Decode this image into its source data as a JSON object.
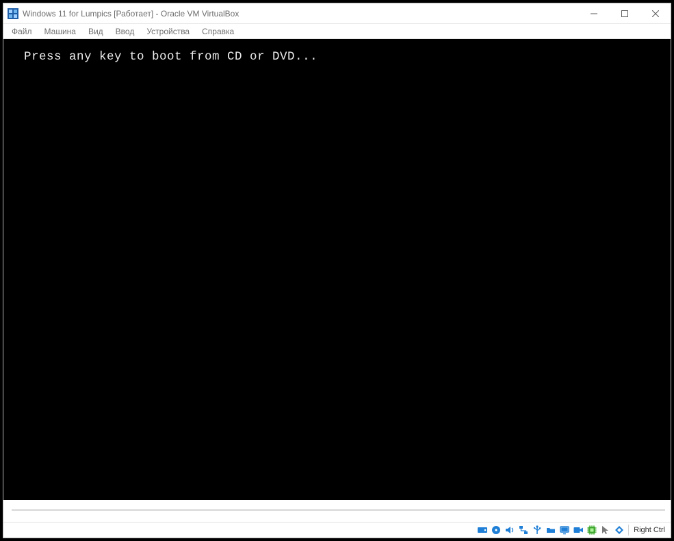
{
  "window": {
    "title": "Windows 11 for Lumpics [Работает] - Oracle VM VirtualBox",
    "controls": {
      "minimize": "minimize",
      "maximize": "maximize",
      "close": "close"
    }
  },
  "menu": {
    "items": [
      "Файл",
      "Машина",
      "Вид",
      "Ввод",
      "Устройства",
      "Справка"
    ]
  },
  "vm": {
    "console_line": "Press any key to boot from CD or DVD..."
  },
  "statusbar": {
    "icons": [
      "hard-disk-icon",
      "optical-disc-icon",
      "audio-icon",
      "network-icon",
      "usb-icon",
      "shared-folders-icon",
      "display-icon",
      "recording-icon",
      "cpu-icon",
      "mouse-integration-icon",
      "keyboard-icon"
    ],
    "hostkey_label": "Right Ctrl"
  },
  "colors": {
    "icon_blue": "#1f7fd6",
    "icon_green": "#3faa2f",
    "icon_orange": "#e58a1f",
    "icon_gray": "#7a7a7a"
  }
}
